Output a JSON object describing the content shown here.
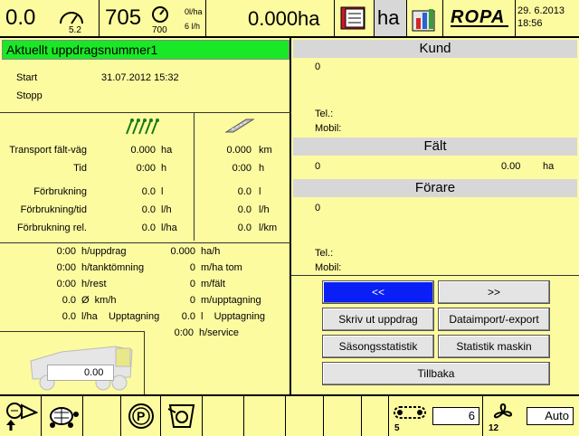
{
  "topbar": {
    "speed_value": "0.0",
    "gauge_sub": "5.2",
    "rpm_value": "705",
    "rpm_sub": "700",
    "rate1": "0l/ha",
    "rate2": "6 l/h",
    "area_value": "0.000ha",
    "ha_label": "ha",
    "brand": "ROPA",
    "date": "29. 6.2013",
    "time": "18:56"
  },
  "left": {
    "title": "Aktuellt uppdragsnummer1",
    "start_label": "Start",
    "start_value": "31.07.2012  15:32",
    "stop_label": "Stopp",
    "rows": [
      {
        "label": "Transport fält-väg",
        "v1": "0.000",
        "u1": "ha",
        "v2": "0.000",
        "u2": "km"
      },
      {
        "label": "Tid",
        "v1": "0:00",
        "u1": "h",
        "v2": "0:00",
        "u2": "h"
      },
      {
        "label": "Förbrukning",
        "v1": "0.0",
        "u1": "l",
        "v2": "0.0",
        "u2": "l"
      },
      {
        "label": "Förbrukning/tid",
        "v1": "0.0",
        "u1": "l/h",
        "v2": "0.0",
        "u2": "l/h"
      },
      {
        "label": "Förbrukning rel.",
        "v1": "0.0",
        "u1": "l/ha",
        "v2": "0.0",
        "u2": "l/km"
      }
    ],
    "stats": [
      {
        "v": "0:00",
        "u": "h/uppdrag",
        "v2": "0.000",
        "u2": "ha/h"
      },
      {
        "v": "0:00",
        "u": "h/tanktömning",
        "v2": "0",
        "u2": "m/ha tom"
      },
      {
        "v": "0:00",
        "u": "h/rest",
        "v2": "0",
        "u2": "m/fält"
      },
      {
        "v": "0.0",
        "u": "Ø  km/h",
        "v2": "0",
        "u2": "m/upptagning"
      },
      {
        "v": "0.0",
        "u": "l/ha    Upptagning",
        "v2": "0.0",
        "u2": "l    Upptagning"
      }
    ],
    "service_v": "0:00",
    "service_u": "h/service",
    "truck_value": "0.00"
  },
  "right": {
    "kund_head": "Kund",
    "kund_value": "0",
    "tel_label": "Tel.:",
    "mobil_label": "Mobil:",
    "falt_head": "Fält",
    "falt_value": "0",
    "falt_area": "0.00",
    "falt_unit": "ha",
    "forare_head": "Förare",
    "forare_value": "0",
    "tel2_label": "Tel.:",
    "mobil2_label": "Mobil:",
    "btn_prev": "<<",
    "btn_next": ">>",
    "btn_print": "Skriv ut uppdrag",
    "btn_import": "Dataimport/-export",
    "btn_season": "Säsongsstatistik",
    "btn_machine": "Statistik maskin",
    "btn_back": "Tillbaka"
  },
  "bottombar": {
    "chain_small": "5",
    "chain_value": "6",
    "fan_small": "12",
    "fan_value": "Auto"
  }
}
